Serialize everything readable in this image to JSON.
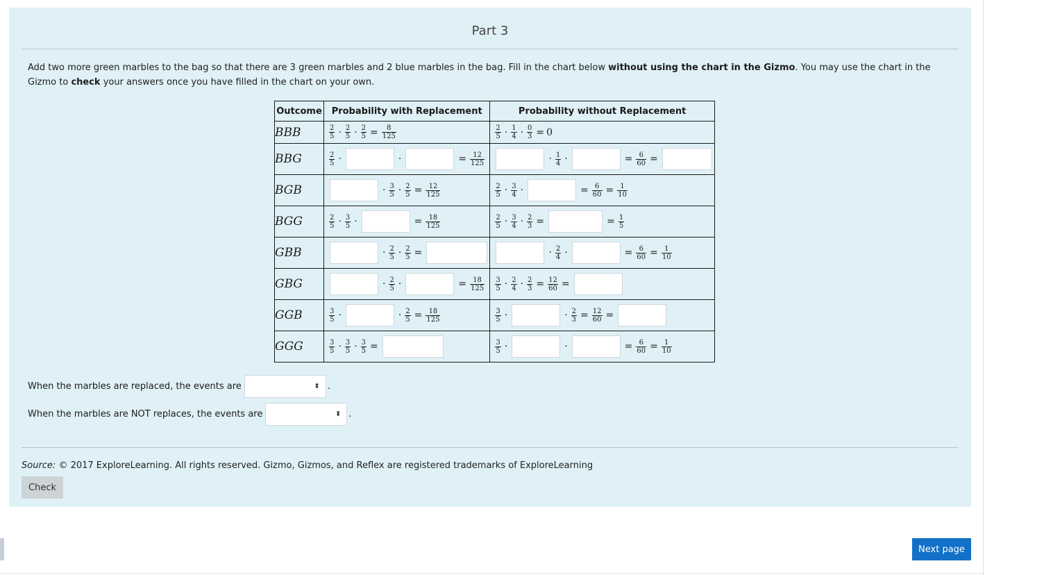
{
  "part_title": "Part 3",
  "instructions": {
    "t1": "Add two more green marbles to the bag so that there are 3 green marbles and 2 blue marbles in the bag. Fill in the chart below ",
    "b1": "without using the chart in the Gizmo",
    "t2": ". You may use the chart in the Gizmo to ",
    "b2": "check",
    "t3": " your answers once you have filled in the chart on your own."
  },
  "table": {
    "headers": [
      "Outcome",
      "Probability with Replacement",
      "Probability without Replacement"
    ],
    "rows": [
      {
        "outcome": "BBB"
      },
      {
        "outcome": "BBG"
      },
      {
        "outcome": "BGB"
      },
      {
        "outcome": "BGG"
      },
      {
        "outcome": "GBB"
      },
      {
        "outcome": "GBG"
      },
      {
        "outcome": "GGB"
      },
      {
        "outcome": "GGG"
      }
    ]
  },
  "math": {
    "n2": "2",
    "n1": "1",
    "n0": "0",
    "n3": "3",
    "n6": "6",
    "n8": "8",
    "n12": "12",
    "n18": "18",
    "d3": "3",
    "d4": "4",
    "d5": "5",
    "d10": "10",
    "d60": "60",
    "d125": "125",
    "zero": "0",
    "dot": "·",
    "eq": "="
  },
  "questions": {
    "replaced": "When the marbles are replaced, the events are",
    "not_replaced": "When the marbles are NOT replaces, the events are",
    "period": "."
  },
  "select_arrow": "⬍",
  "source": {
    "label": "Source:",
    "text": " © 2017 ExploreLearning.  All rights reserved.  Gizmo, Gizmos, and Reflex are registered trademarks of ExploreLearning"
  },
  "buttons": {
    "check": "Check",
    "next": "Next page"
  }
}
